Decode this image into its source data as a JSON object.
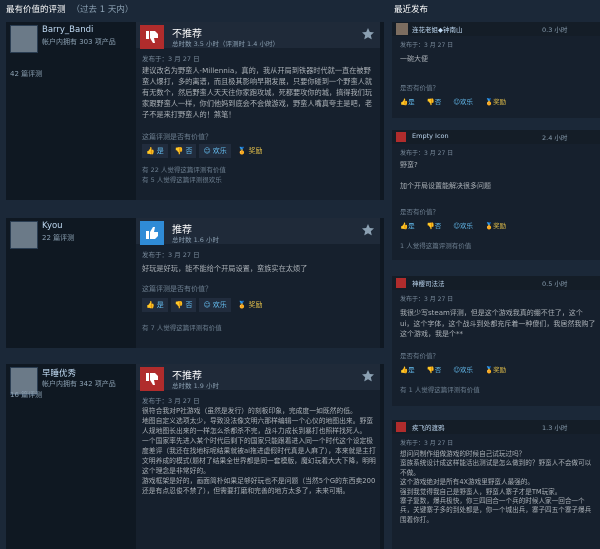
{
  "left_header": {
    "title": "最有价值的评测",
    "range": "（过去 1 天内）"
  },
  "right_header": {
    "title": "最近发布"
  },
  "vote_labels": {
    "yes": "是",
    "no": "否",
    "funny": "欢乐",
    "award": "奖励"
  },
  "reviews": [
    {
      "author": "Barry_Bandi",
      "owned": "帐户内拥有 303 项产品",
      "review_count": "42 篇评测",
      "recommendation": "不推荐",
      "hours": "总时数 3.5 小时（评测时 1.4 小时）",
      "posted": "发布于：3 月 27 日",
      "text": "建议改名为野蛮人-Millennia，真的，我从开局到铁器时代就一直在被野蛮人爆打，多的离谱，而且极其影响早期发展，只要你碰到一个野蛮人就有无数个，然后野蛮人天天往你家跑攻城，死都要攻你的城，搞得我们玩家跟野蛮人一样，你们他妈到底会不会做游戏，野蛮人嘴真夸主是吧，老子不是来打野蛮人的！煞笔！",
      "helpful_q": "这篇评测是否有价值？",
      "stats": [
        "有 22 人觉得这篇评测有价值",
        "有 5 人觉得这篇评测很欢乐"
      ]
    },
    {
      "author": "Kyou",
      "owned": "",
      "review_count": "22 篇评测",
      "recommendation": "推荐",
      "hours": "总时数 1.6 小时",
      "posted": "发布于：3 月 27 日",
      "text": "好玩是好玩，能不能给个开局设置，蛮族实在太烦了",
      "helpful_q": "这篇评测是否有价值？",
      "stats": [
        "有 7 人觉得这篇评测有价值"
      ]
    },
    {
      "author": "早睡优秀",
      "owned": "帐户内拥有 342 项产品",
      "review_count": "16 篇评测",
      "recommendation": "不推荐",
      "hours": "总时数 1.9 小时",
      "posted": "发布于：3 月 27 日",
      "text": "很符合我对P社游戏（虽然是发行）的刻板印象，完成度一如既然的低。\n地图自定义选项太少，导致没法像文明六那样编辑一个心仪的地图出来。野蛮人规地图长出来的一样怎么杀都杀不完，战斗力成长到暴打也照样找死人。\n一个国家率先进入某个时代后剩下的国家只能跟着进入同一个时代这个设定极度差评（我还在找地标呢结果就被ai拖进虚假时代真是人麻了），本来就是主打文明养成的模式(题材了结果全世界都是同一套模版，魔幻玩着大大下降，明明这个理念是非常好的。\n游戏框架是好的，画面简朴如果足够好玩也不是问题（当然5个G的东西卖200还是有点忍俊不禁了），但需要打磨和完善的地方太多了，未来可期。",
      "helpful_q": "",
      "stats": []
    }
  ],
  "recent": [
    {
      "name": "连花老姐◆钟南山",
      "time": "0.3 小时",
      "posted": "发布于：3 月 27 日",
      "text": "一碗大便",
      "helpful_q": "是否有价值？",
      "stats": []
    },
    {
      "name": "Empty Icon",
      "time": "2.4 小时",
      "posted": "发布于：3 月 27 日",
      "text": "野蛮?\n\n加个开局设置能解决很多问题",
      "helpful_q": "是否有价值？",
      "stats": [
        "1 人觉得这篇评测有价值"
      ]
    },
    {
      "name": "神樱司法法",
      "time": "0.5 小时",
      "posted": "发布于：3 月 27 日",
      "text": "我很少写steam评测，但是这个游戏我真的绷不住了，这个ui，这个字体，这个战斗到处都充斥着一种傻们，我居然我购了这个游戏，我是个**",
      "helpful_q": "是否有价值？",
      "stats": [
        "有 1 人觉得这篇评测有价值"
      ]
    },
    {
      "name": "疾飞的渡鸦",
      "time": "1.3 小时",
      "posted": "发布于：3 月 27 日",
      "text": "想问问制作组做游戏的时候自己试玩过吗？\n蛮族系统设计成这样能活出测试是怎么做到的？野蛮人不会做可以不做。\n这个游戏绝对是所有4X游戏里野蛮人最强的。\n强到我觉得我自己是野蛮人，野蛮人寨子才是TM玩家。\n寨子复数，爆兵极快，你三四回合一个兵的时候人家一回合一个兵，关键寨子多的到处都是，你一个城出兵，寨子四五个寨子爆兵围着你打。",
      "helpful_q": "",
      "stats": []
    }
  ]
}
